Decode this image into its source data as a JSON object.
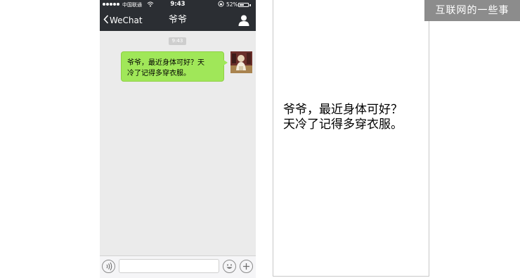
{
  "status_bar": {
    "carrier": "中国联通",
    "time": "9:43",
    "battery_percent": "52%",
    "battery_level": 0.52,
    "icons": [
      "signal-dots-icon",
      "wifi-icon",
      "rotation-lock-icon",
      "battery-icon"
    ]
  },
  "nav": {
    "back_label": "WeChat",
    "title": "爷爷",
    "profile_icon": "person-icon"
  },
  "chat": {
    "timestamp": "9:43",
    "messages": [
      {
        "sender": "self",
        "lines": [
          "爷爷，最近身体可好？天",
          "冷了记得多穿衣服。"
        ]
      }
    ]
  },
  "input_bar": {
    "value": "",
    "icons": [
      "voice-icon",
      "emoji-icon",
      "plus-icon"
    ]
  },
  "preview": {
    "lines": [
      "爷爷，最近身体可好？",
      "天冷了记得多穿衣服。"
    ]
  },
  "watermark": {
    "text": "互联网的一些事"
  },
  "colors": {
    "nav_bg": "#2b2e33",
    "chat_bg": "#ebebeb",
    "bubble_green": "#a0e759",
    "badge_gray": "#8c8c8c"
  }
}
